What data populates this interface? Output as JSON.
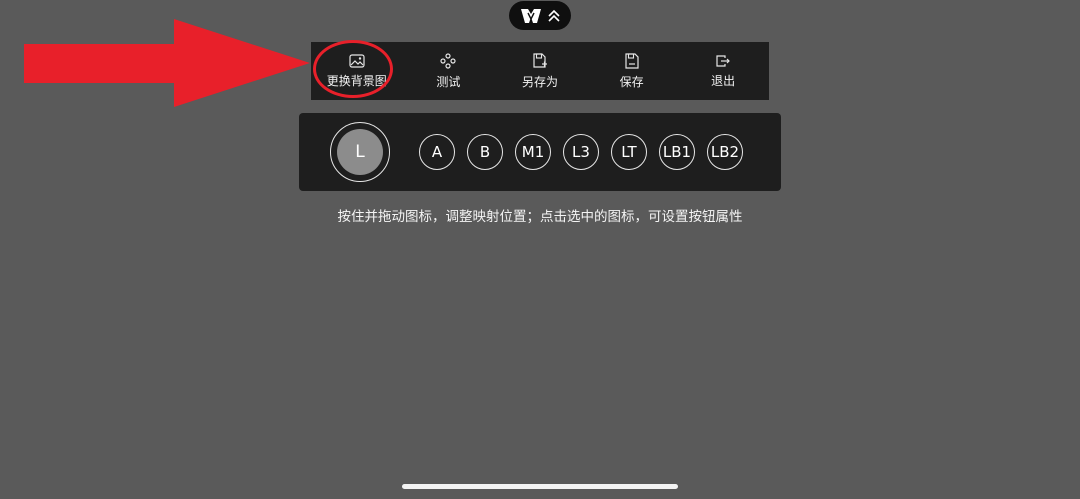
{
  "top_pill": {
    "logo_icon": "brand-logo-icon",
    "expand_icon": "double-chevron-up-icon"
  },
  "toolbar": {
    "items": [
      {
        "label": "更换背景图",
        "icon": "image-icon"
      },
      {
        "label": "测试",
        "icon": "gamepad-dpad-icon"
      },
      {
        "label": "另存为",
        "icon": "save-as-icon"
      },
      {
        "label": "保存",
        "icon": "save-icon"
      },
      {
        "label": "退出",
        "icon": "exit-icon"
      }
    ]
  },
  "panel": {
    "stick_label": "L",
    "buttons": [
      "A",
      "B",
      "M1",
      "L3",
      "LT",
      "LB1",
      "LB2"
    ]
  },
  "hint": "按住并拖动图标，调整映射位置；点击选中的图标，可设置按钮属性",
  "colors": {
    "background": "#5a5a5a",
    "panel": "#1e1e1e",
    "annotation": "#e8202a"
  }
}
